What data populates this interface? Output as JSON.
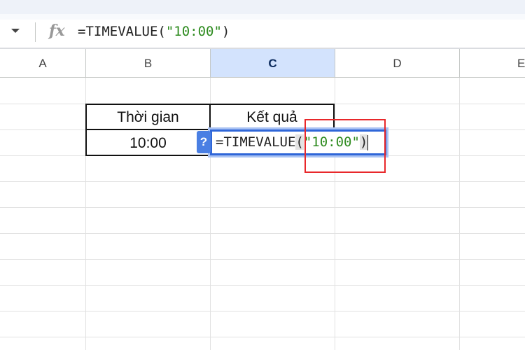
{
  "formula_bar": {
    "prefix": "=TIMEVALUE(",
    "string": "\"10:00\"",
    "suffix": ")",
    "fx_label": "fx"
  },
  "columns": [
    "A",
    "B",
    "C",
    "D",
    "E"
  ],
  "selected_column": "C",
  "cells": {
    "B2": "Thời gian",
    "C2": "Kết quả",
    "B3": "10:00"
  },
  "editor": {
    "help_label": "?",
    "prefix": "=TIMEVALUE",
    "open_paren": "(",
    "string": "\"10:00\"",
    "close_paren": ")"
  },
  "colors": {
    "accent": "#2f66d8",
    "highlight": "#e8282b",
    "string": "#2e8b1f"
  }
}
